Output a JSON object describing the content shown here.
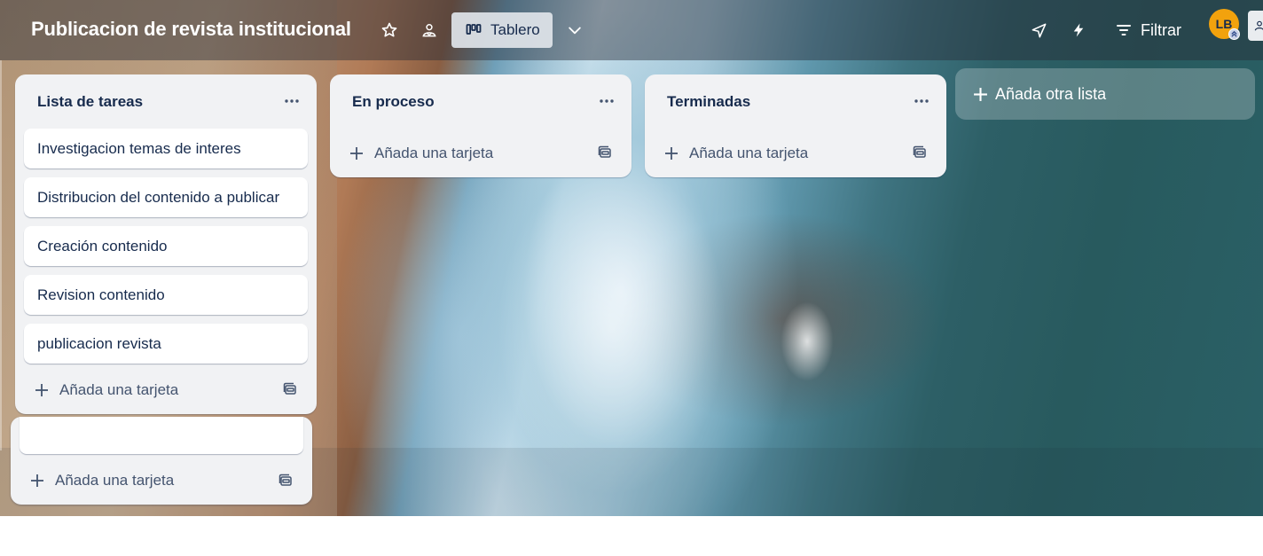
{
  "header": {
    "board_title": "Publicacion de revista institucional",
    "view_label": "Tablero",
    "filter_label": "Filtrar",
    "avatar_initials": "LB",
    "icons": [
      "star-icon",
      "workspace-visibility-icon",
      "board-view-icon",
      "chevron-down-icon",
      "power-up-icon",
      "automation-icon",
      "filter-icon",
      "share-icon"
    ]
  },
  "lists": [
    {
      "title": "Lista de tareas",
      "cards": [
        "Investigacion temas de interes",
        "Distribucion del contenido a publicar",
        "Creación contenido",
        "Revision contenido",
        "publicacion revista"
      ],
      "add_card_label": "Añada una tarjeta"
    },
    {
      "title": "En proceso",
      "cards": [],
      "add_card_label": "Añada una tarjeta"
    },
    {
      "title": "Terminadas",
      "cards": [],
      "add_card_label": "Añada una tarjeta"
    }
  ],
  "add_list_label": "Añada otra lista",
  "ghost_list": {
    "add_card_label": "Añada una tarjeta"
  },
  "colors": {
    "header_text": "#ffffff",
    "list_bg": "#f1f2f4",
    "card_bg": "#ffffff",
    "text_primary": "#172b4d",
    "text_subtle": "#44546f",
    "avatar": "#f2a20d"
  }
}
